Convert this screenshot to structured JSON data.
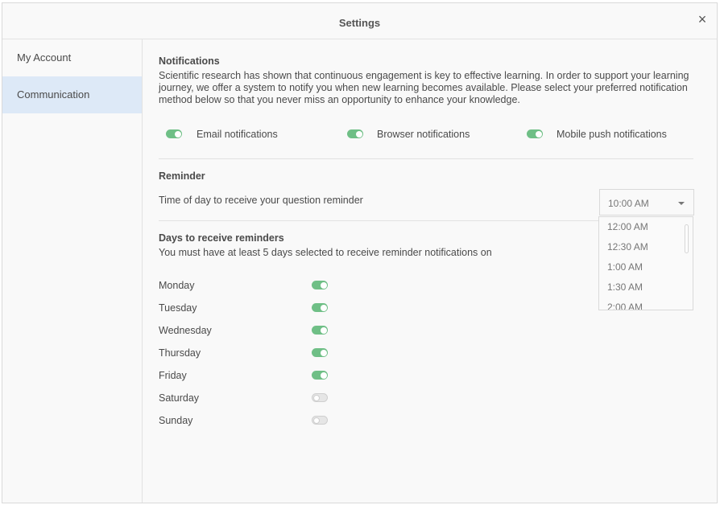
{
  "dialog": {
    "title": "Settings",
    "close_glyph": "×"
  },
  "sidebar": {
    "items": [
      {
        "label": "My Account",
        "active": false
      },
      {
        "label": "Communication",
        "active": true
      }
    ]
  },
  "notifications": {
    "title": "Notifications",
    "description_lines": [
      "Scientific research has shown that continuous engagement is key to effective learning. In order to support your learning",
      "journey, we offer a system to notify you when new learning becomes available. Please select your preferred notification",
      "method below so that you never miss an opportunity to enhance your knowledge."
    ],
    "toggles": [
      {
        "label": "Email notifications",
        "on": true
      },
      {
        "label": "Browser notifications",
        "on": true
      },
      {
        "label": "Mobile push notifications",
        "on": true
      }
    ]
  },
  "reminder": {
    "title": "Reminder",
    "time_label": "Time of day to receive your question reminder",
    "selected_time": "10:00 AM",
    "time_options": [
      "12:00 AM",
      "12:30 AM",
      "1:00 AM",
      "1:30 AM",
      "2:00 AM"
    ]
  },
  "days": {
    "title": "Days to receive reminders",
    "subtitle": "You must have at least 5 days selected to receive reminder notifications on",
    "items": [
      {
        "label": "Monday",
        "on": true
      },
      {
        "label": "Tuesday",
        "on": true
      },
      {
        "label": "Wednesday",
        "on": true
      },
      {
        "label": "Thursday",
        "on": true
      },
      {
        "label": "Friday",
        "on": true
      },
      {
        "label": "Saturday",
        "on": false
      },
      {
        "label": "Sunday",
        "on": false
      }
    ]
  },
  "colors": {
    "toggle_on": "#6fbf86",
    "toggle_off": "#e6e6e6",
    "active_nav": "#dde9f7"
  }
}
